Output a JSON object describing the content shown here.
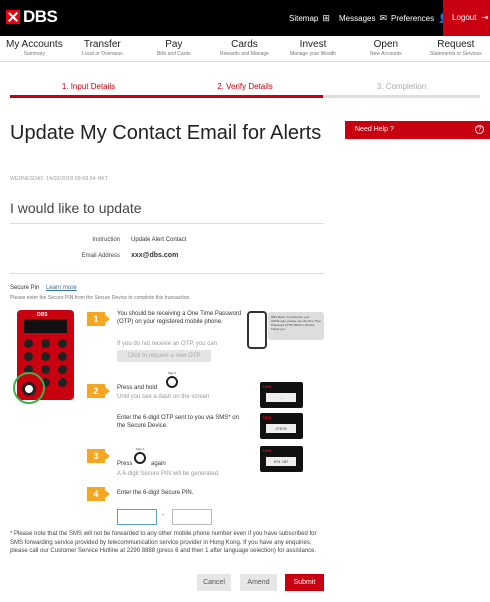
{
  "brand": {
    "logo_text": "DBS",
    "accent": "#c8000f",
    "step_accent": "#f5a623"
  },
  "topbar": {
    "sitemap": "Sitemap",
    "messages": "Messages",
    "preferences": "Preferences",
    "logout": "Logout"
  },
  "nav": [
    {
      "label": "My Accounts",
      "sub": "Summary"
    },
    {
      "label": "Transfer",
      "sub": "Local or Overseas"
    },
    {
      "label": "Pay",
      "sub": "Bills and Cards"
    },
    {
      "label": "Cards",
      "sub": "Rewards and Manage"
    },
    {
      "label": "Invest",
      "sub": "Manage your Wealth"
    },
    {
      "label": "Open",
      "sub": "New Accounts"
    },
    {
      "label": "Request",
      "sub": "Statements or Services"
    }
  ],
  "steps": [
    {
      "label": "1. Input Details",
      "state": "done"
    },
    {
      "label": "2. Verify Details",
      "state": "active"
    },
    {
      "label": "3. Completion",
      "state": "pending"
    }
  ],
  "page": {
    "title": "Update My Contact Email for Alerts",
    "timestamp": "WEDNESDAY, 14/02/2018 09:08:54 HKT",
    "subtitle": "I would like to update"
  },
  "details": {
    "instruction_label": "Instruction",
    "instruction_value": "Update Alert Contact",
    "email_label": "Email Address",
    "email_value": "xxx@dbs.com"
  },
  "help": {
    "label": "Need Help ?",
    "icon": "question-circle-icon"
  },
  "secure_pin": {
    "label": "Secure Pin",
    "learn_more": "Learn more",
    "desc": "Please enter the Secure PIN from the Secure Device to complete this transaction.",
    "device_brand": "DBS"
  },
  "instructions": {
    "step1_num": "1",
    "step1_text": "You should be receiving a One Time Password (OTP) on your registered mobile phone.",
    "step1_sub": "If you do not receive an OTP, you can",
    "otp_button": "Click to request a new OTP",
    "sms_text": "DBS Bank: To authorize your ePIN/Login, please use the One Time Password (OTP) 8623 in 10mins. Thank you",
    "step2_num": "2",
    "step2_text": "Press and hold",
    "step2_sub": "Until you see a dash on the screen",
    "step2_text2": "Enter the 6-digit OTP sent to you via SMS* on the Secure Device.",
    "sign_label": "Sign 1",
    "screen_dash": "-",
    "screen_otp": "2?6?5",
    "step3_num": "3",
    "step3_press": "Press",
    "step3_again": "again",
    "step3_sub": "A 6-digit Secure PIN will be generated.",
    "screen_pin": "9?4 ?8?",
    "step4_num": "4",
    "step4_text": "Enter the 6-digit Secure PIN.",
    "pin_separator": "-"
  },
  "note": "* Please note that the SMS will not be forwarded to any other mobile phone number even if you have subscribed for SMS forwarding service provided by telecommunication service provider in Hong Kong. If you have any enquiries, please call our Customer Service Hotline at 2290 8888 (press 6 and then 1 after language selection) for assistance.",
  "buttons": {
    "cancel": "Cancel",
    "amend": "Amend",
    "submit": "Submit"
  }
}
